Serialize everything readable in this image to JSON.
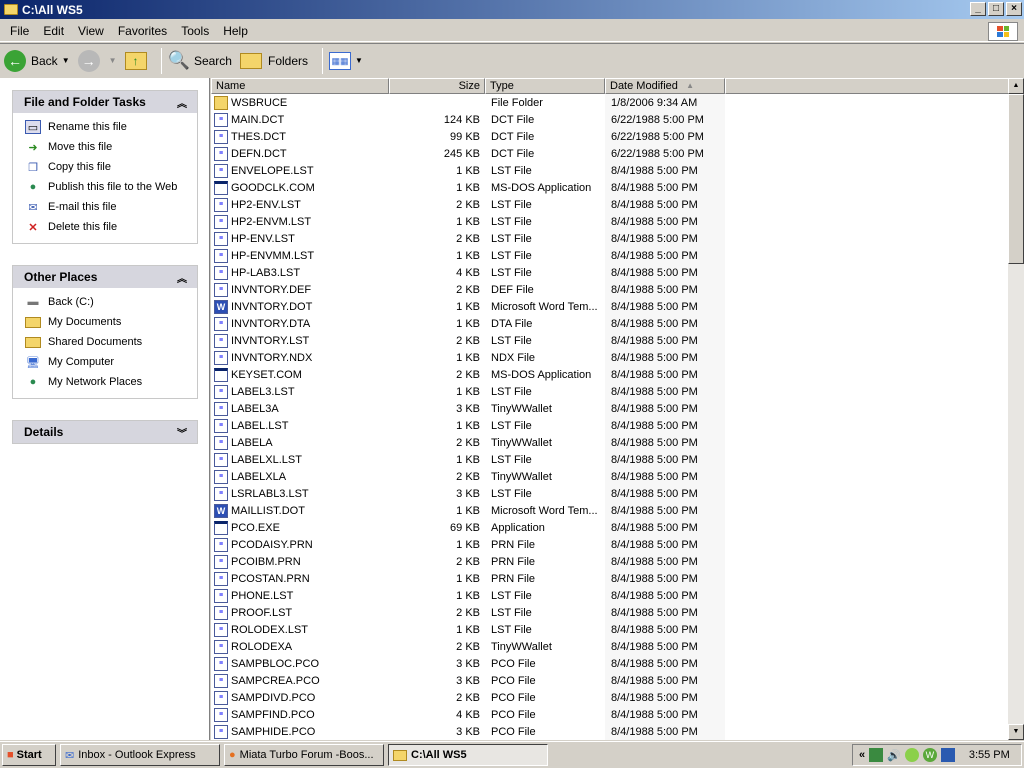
{
  "window": {
    "title": "C:\\All WS5"
  },
  "menu": [
    "File",
    "Edit",
    "View",
    "Favorites",
    "Tools",
    "Help"
  ],
  "toolbar": {
    "back": "Back",
    "search": "Search",
    "folders": "Folders"
  },
  "tasks_panel": {
    "title": "File and Folder Tasks",
    "items": [
      "Rename this file",
      "Move this file",
      "Copy this file",
      "Publish this file to the Web",
      "E-mail this file",
      "Delete this file"
    ]
  },
  "places_panel": {
    "title": "Other Places",
    "items": [
      "Back (C:)",
      "My Documents",
      "Shared Documents",
      "My Computer",
      "My Network Places"
    ]
  },
  "details_panel": {
    "title": "Details"
  },
  "columns": {
    "name": "Name",
    "size": "Size",
    "type": "Type",
    "date": "Date Modified"
  },
  "files": [
    [
      "WSBRUCE",
      "",
      "File Folder",
      "1/8/2006 9:34 AM",
      "folder"
    ],
    [
      "MAIN.DCT",
      "124 KB",
      "DCT File",
      "6/22/1988 5:00 PM",
      "doc"
    ],
    [
      "THES.DCT",
      "99 KB",
      "DCT File",
      "6/22/1988 5:00 PM",
      "doc"
    ],
    [
      "DEFN.DCT",
      "245 KB",
      "DCT File",
      "6/22/1988 5:00 PM",
      "doc"
    ],
    [
      "ENVELOPE.LST",
      "1 KB",
      "LST File",
      "8/4/1988 5:00 PM",
      "doc"
    ],
    [
      "GOODCLK.COM",
      "1 KB",
      "MS-DOS Application",
      "8/4/1988 5:00 PM",
      "app"
    ],
    [
      "HP2-ENV.LST",
      "2 KB",
      "LST File",
      "8/4/1988 5:00 PM",
      "doc"
    ],
    [
      "HP2-ENVM.LST",
      "1 KB",
      "LST File",
      "8/4/1988 5:00 PM",
      "doc"
    ],
    [
      "HP-ENV.LST",
      "2 KB",
      "LST File",
      "8/4/1988 5:00 PM",
      "doc"
    ],
    [
      "HP-ENVMM.LST",
      "1 KB",
      "LST File",
      "8/4/1988 5:00 PM",
      "doc"
    ],
    [
      "HP-LAB3.LST",
      "4 KB",
      "LST File",
      "8/4/1988 5:00 PM",
      "doc"
    ],
    [
      "INVNTORY.DEF",
      "2 KB",
      "DEF File",
      "8/4/1988 5:00 PM",
      "doc"
    ],
    [
      "INVNTORY.DOT",
      "1 KB",
      "Microsoft Word Tem...",
      "8/4/1988 5:00 PM",
      "word"
    ],
    [
      "INVNTORY.DTA",
      "1 KB",
      "DTA File",
      "8/4/1988 5:00 PM",
      "doc"
    ],
    [
      "INVNTORY.LST",
      "2 KB",
      "LST File",
      "8/4/1988 5:00 PM",
      "doc"
    ],
    [
      "INVNTORY.NDX",
      "1 KB",
      "NDX File",
      "8/4/1988 5:00 PM",
      "doc"
    ],
    [
      "KEYSET.COM",
      "2 KB",
      "MS-DOS Application",
      "8/4/1988 5:00 PM",
      "app"
    ],
    [
      "LABEL3.LST",
      "1 KB",
      "LST File",
      "8/4/1988 5:00 PM",
      "doc"
    ],
    [
      "LABEL3A",
      "3 KB",
      "TinyWWallet",
      "8/4/1988 5:00 PM",
      "doc"
    ],
    [
      "LABEL.LST",
      "1 KB",
      "LST File",
      "8/4/1988 5:00 PM",
      "doc"
    ],
    [
      "LABELA",
      "2 KB",
      "TinyWWallet",
      "8/4/1988 5:00 PM",
      "doc"
    ],
    [
      "LABELXL.LST",
      "1 KB",
      "LST File",
      "8/4/1988 5:00 PM",
      "doc"
    ],
    [
      "LABELXLA",
      "2 KB",
      "TinyWWallet",
      "8/4/1988 5:00 PM",
      "doc"
    ],
    [
      "LSRLABL3.LST",
      "3 KB",
      "LST File",
      "8/4/1988 5:00 PM",
      "doc"
    ],
    [
      "MAILLIST.DOT",
      "1 KB",
      "Microsoft Word Tem...",
      "8/4/1988 5:00 PM",
      "word"
    ],
    [
      "PCO.EXE",
      "69 KB",
      "Application",
      "8/4/1988 5:00 PM",
      "app"
    ],
    [
      "PCODAISY.PRN",
      "1 KB",
      "PRN File",
      "8/4/1988 5:00 PM",
      "doc"
    ],
    [
      "PCOIBM.PRN",
      "2 KB",
      "PRN File",
      "8/4/1988 5:00 PM",
      "doc"
    ],
    [
      "PCOSTAN.PRN",
      "1 KB",
      "PRN File",
      "8/4/1988 5:00 PM",
      "doc"
    ],
    [
      "PHONE.LST",
      "1 KB",
      "LST File",
      "8/4/1988 5:00 PM",
      "doc"
    ],
    [
      "PROOF.LST",
      "2 KB",
      "LST File",
      "8/4/1988 5:00 PM",
      "doc"
    ],
    [
      "ROLODEX.LST",
      "1 KB",
      "LST File",
      "8/4/1988 5:00 PM",
      "doc"
    ],
    [
      "ROLODEXA",
      "2 KB",
      "TinyWWallet",
      "8/4/1988 5:00 PM",
      "doc"
    ],
    [
      "SAMPBLOC.PCO",
      "3 KB",
      "PCO File",
      "8/4/1988 5:00 PM",
      "doc"
    ],
    [
      "SAMPCREA.PCO",
      "3 KB",
      "PCO File",
      "8/4/1988 5:00 PM",
      "doc"
    ],
    [
      "SAMPDIVD.PCO",
      "2 KB",
      "PCO File",
      "8/4/1988 5:00 PM",
      "doc"
    ],
    [
      "SAMPFIND.PCO",
      "4 KB",
      "PCO File",
      "8/4/1988 5:00 PM",
      "doc"
    ],
    [
      "SAMPHIDE.PCO",
      "3 KB",
      "PCO File",
      "8/4/1988 5:00 PM",
      "doc"
    ]
  ],
  "taskbar": {
    "start": "Start",
    "tasks": [
      "Inbox - Outlook Express",
      "Miata Turbo Forum -Boos...",
      "C:\\All WS5"
    ],
    "clock": "3:55 PM"
  }
}
